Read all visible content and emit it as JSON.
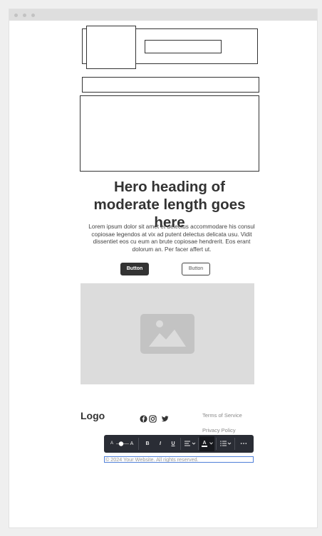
{
  "hero": {
    "heading": "Hero heading of moderate length goes here",
    "paragraph": "Lorem ipsum dolor sit amet et delectus accommodare his consul copiosae legendos at vix ad putent delectus delicata usu. Vidit dissentiet eos cu eum an brute copiosae hendrerit. Eos erant dolorum an. Per facer affert ut.",
    "primary_button": "Button",
    "secondary_button": "Button"
  },
  "footer": {
    "logo": "Logo",
    "links": [
      "Terms of Service",
      "Privacy Policy"
    ],
    "copyright": "© 2024 Your Website. All rights reserved."
  },
  "social_icons": [
    "facebook-icon",
    "instagram-icon",
    "twitter-icon"
  ],
  "toolbar": {
    "font_size_small": "A",
    "font_size_large": "A",
    "bold": "B",
    "italic": "I",
    "underline": "U",
    "text_color": "A",
    "more": "⋯"
  },
  "colors": {
    "toolbar_bg": "#2a2d35",
    "selection_outline": "#4f7fd8",
    "primary_button": "#333333"
  }
}
